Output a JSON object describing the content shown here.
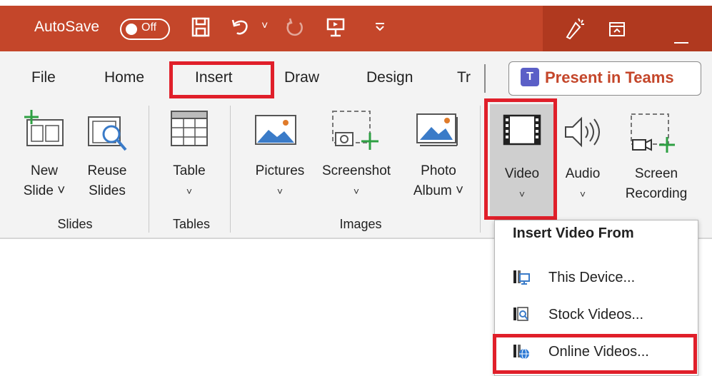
{
  "titlebar": {
    "autosave_label": "AutoSave",
    "autosave_state": "Off",
    "icons": [
      "save-icon",
      "undo-icon",
      "redo-icon",
      "present-from-start-icon",
      "customize-qat-icon",
      "designer-icon",
      "ribbon-display-icon",
      "minimize-icon"
    ]
  },
  "ribbon": {
    "tabs": [
      "File",
      "Home",
      "Insert",
      "Draw",
      "Design",
      "Tr"
    ],
    "active_tab": "Insert",
    "present_in_teams": "Present in Teams",
    "commands": {
      "new_slide": [
        "New",
        "Slide ˅"
      ],
      "reuse_slides": [
        "Reuse",
        "Slides"
      ],
      "table": [
        "Table",
        "˅"
      ],
      "pictures": [
        "Pictures",
        "˅"
      ],
      "screenshot": [
        "Screenshot",
        "˅"
      ],
      "photo_album": [
        "Photo",
        "Album ˅"
      ],
      "video": [
        "Video",
        "˅"
      ],
      "audio": [
        "Audio",
        "˅"
      ],
      "screen_recording": [
        "Screen",
        "Recording"
      ]
    },
    "groups": {
      "slides": "Slides",
      "tables": "Tables",
      "images": "Images"
    }
  },
  "dropdown": {
    "header": "Insert Video From",
    "items": [
      {
        "label": "This Device...",
        "icon": "device-video-icon"
      },
      {
        "label": "Stock Videos...",
        "icon": "stock-video-icon"
      },
      {
        "label": "Online Videos...",
        "icon": "online-video-icon"
      }
    ]
  },
  "colors": {
    "titlebar": "#c4462a",
    "highlight": "#e01f2a",
    "teams": "#5b5fc7"
  }
}
